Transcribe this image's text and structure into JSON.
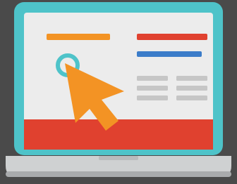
{
  "illustration": {
    "subject": "laptop-click-icon",
    "colors": {
      "background": "#4a4a4a",
      "laptop_frame": "#4ec3c9",
      "screen": "#ececec",
      "orange_accent": "#f39324",
      "red_accent": "#e0412f",
      "blue_accent": "#3b7cc9",
      "gray_lines": "#c6c6c6",
      "base": "#cfd1d2",
      "base_shadow": "#a9abad"
    },
    "icons": [
      "laptop-icon",
      "cursor-arrow-icon",
      "click-ring-icon"
    ]
  }
}
